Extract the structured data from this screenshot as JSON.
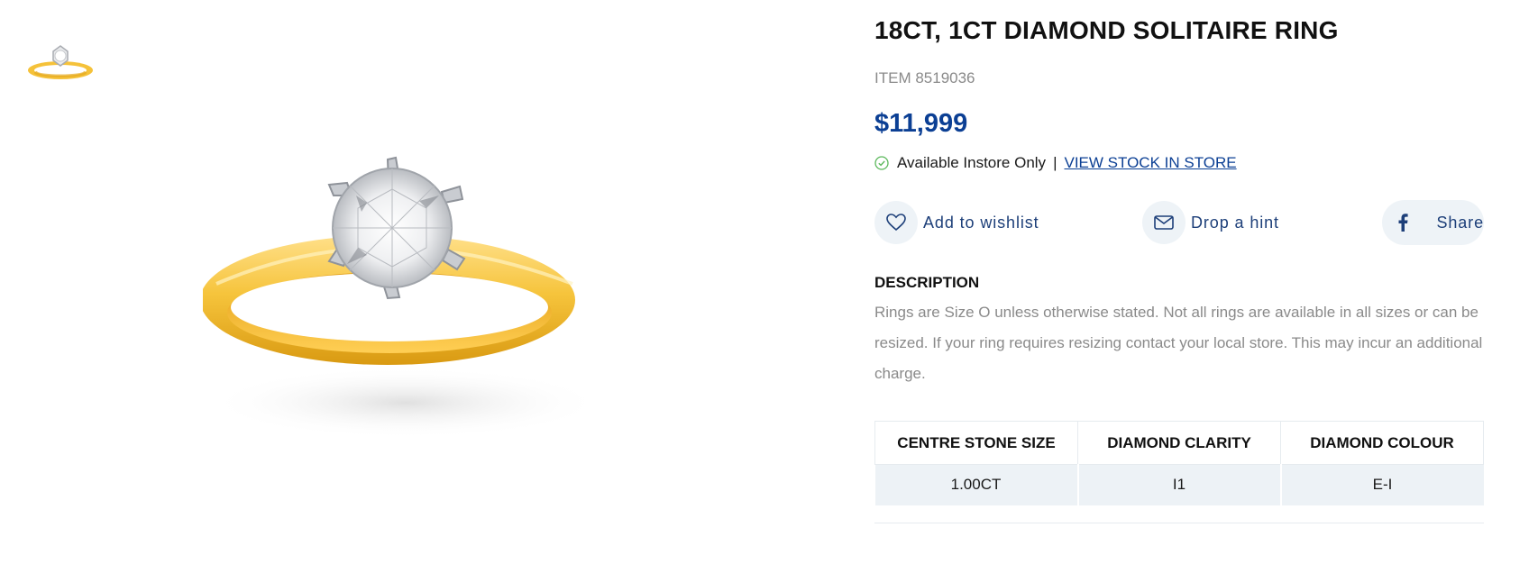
{
  "product": {
    "title": "18CT, 1CT DIAMOND SOLITAIRE RING",
    "item_number": "ITEM 8519036",
    "price": "$11,999",
    "availability": "Available Instore Only",
    "availability_separator": "|",
    "view_stock_link": "VIEW STOCK IN STORE"
  },
  "actions": {
    "wishlist_label": "Add to wishlist",
    "hint_label": "Drop a hint",
    "share_label": "Share"
  },
  "description": {
    "heading": "DESCRIPTION",
    "body": "Rings are Size O unless otherwise stated. Not all rings are available in all sizes or can be resized. If your ring requires resizing contact your local store. This may incur an additional charge."
  },
  "specs": {
    "headers": [
      "CENTRE STONE SIZE",
      "DIAMOND CLARITY",
      "DIAMOND COLOUR"
    ],
    "values": [
      "1.00CT",
      "I1",
      "E-I"
    ]
  },
  "icons": {
    "availability": "check-circle-icon",
    "wishlist": "heart-icon",
    "hint": "envelope-icon",
    "share": "facebook-icon"
  },
  "colors": {
    "brand_blue": "#0b3f94",
    "action_blue": "#1d3f79",
    "muted_text": "#8a8a8a",
    "available_green": "#5cb85c",
    "button_bg": "#eef3f7",
    "table_row_bg": "#edf2f6"
  }
}
